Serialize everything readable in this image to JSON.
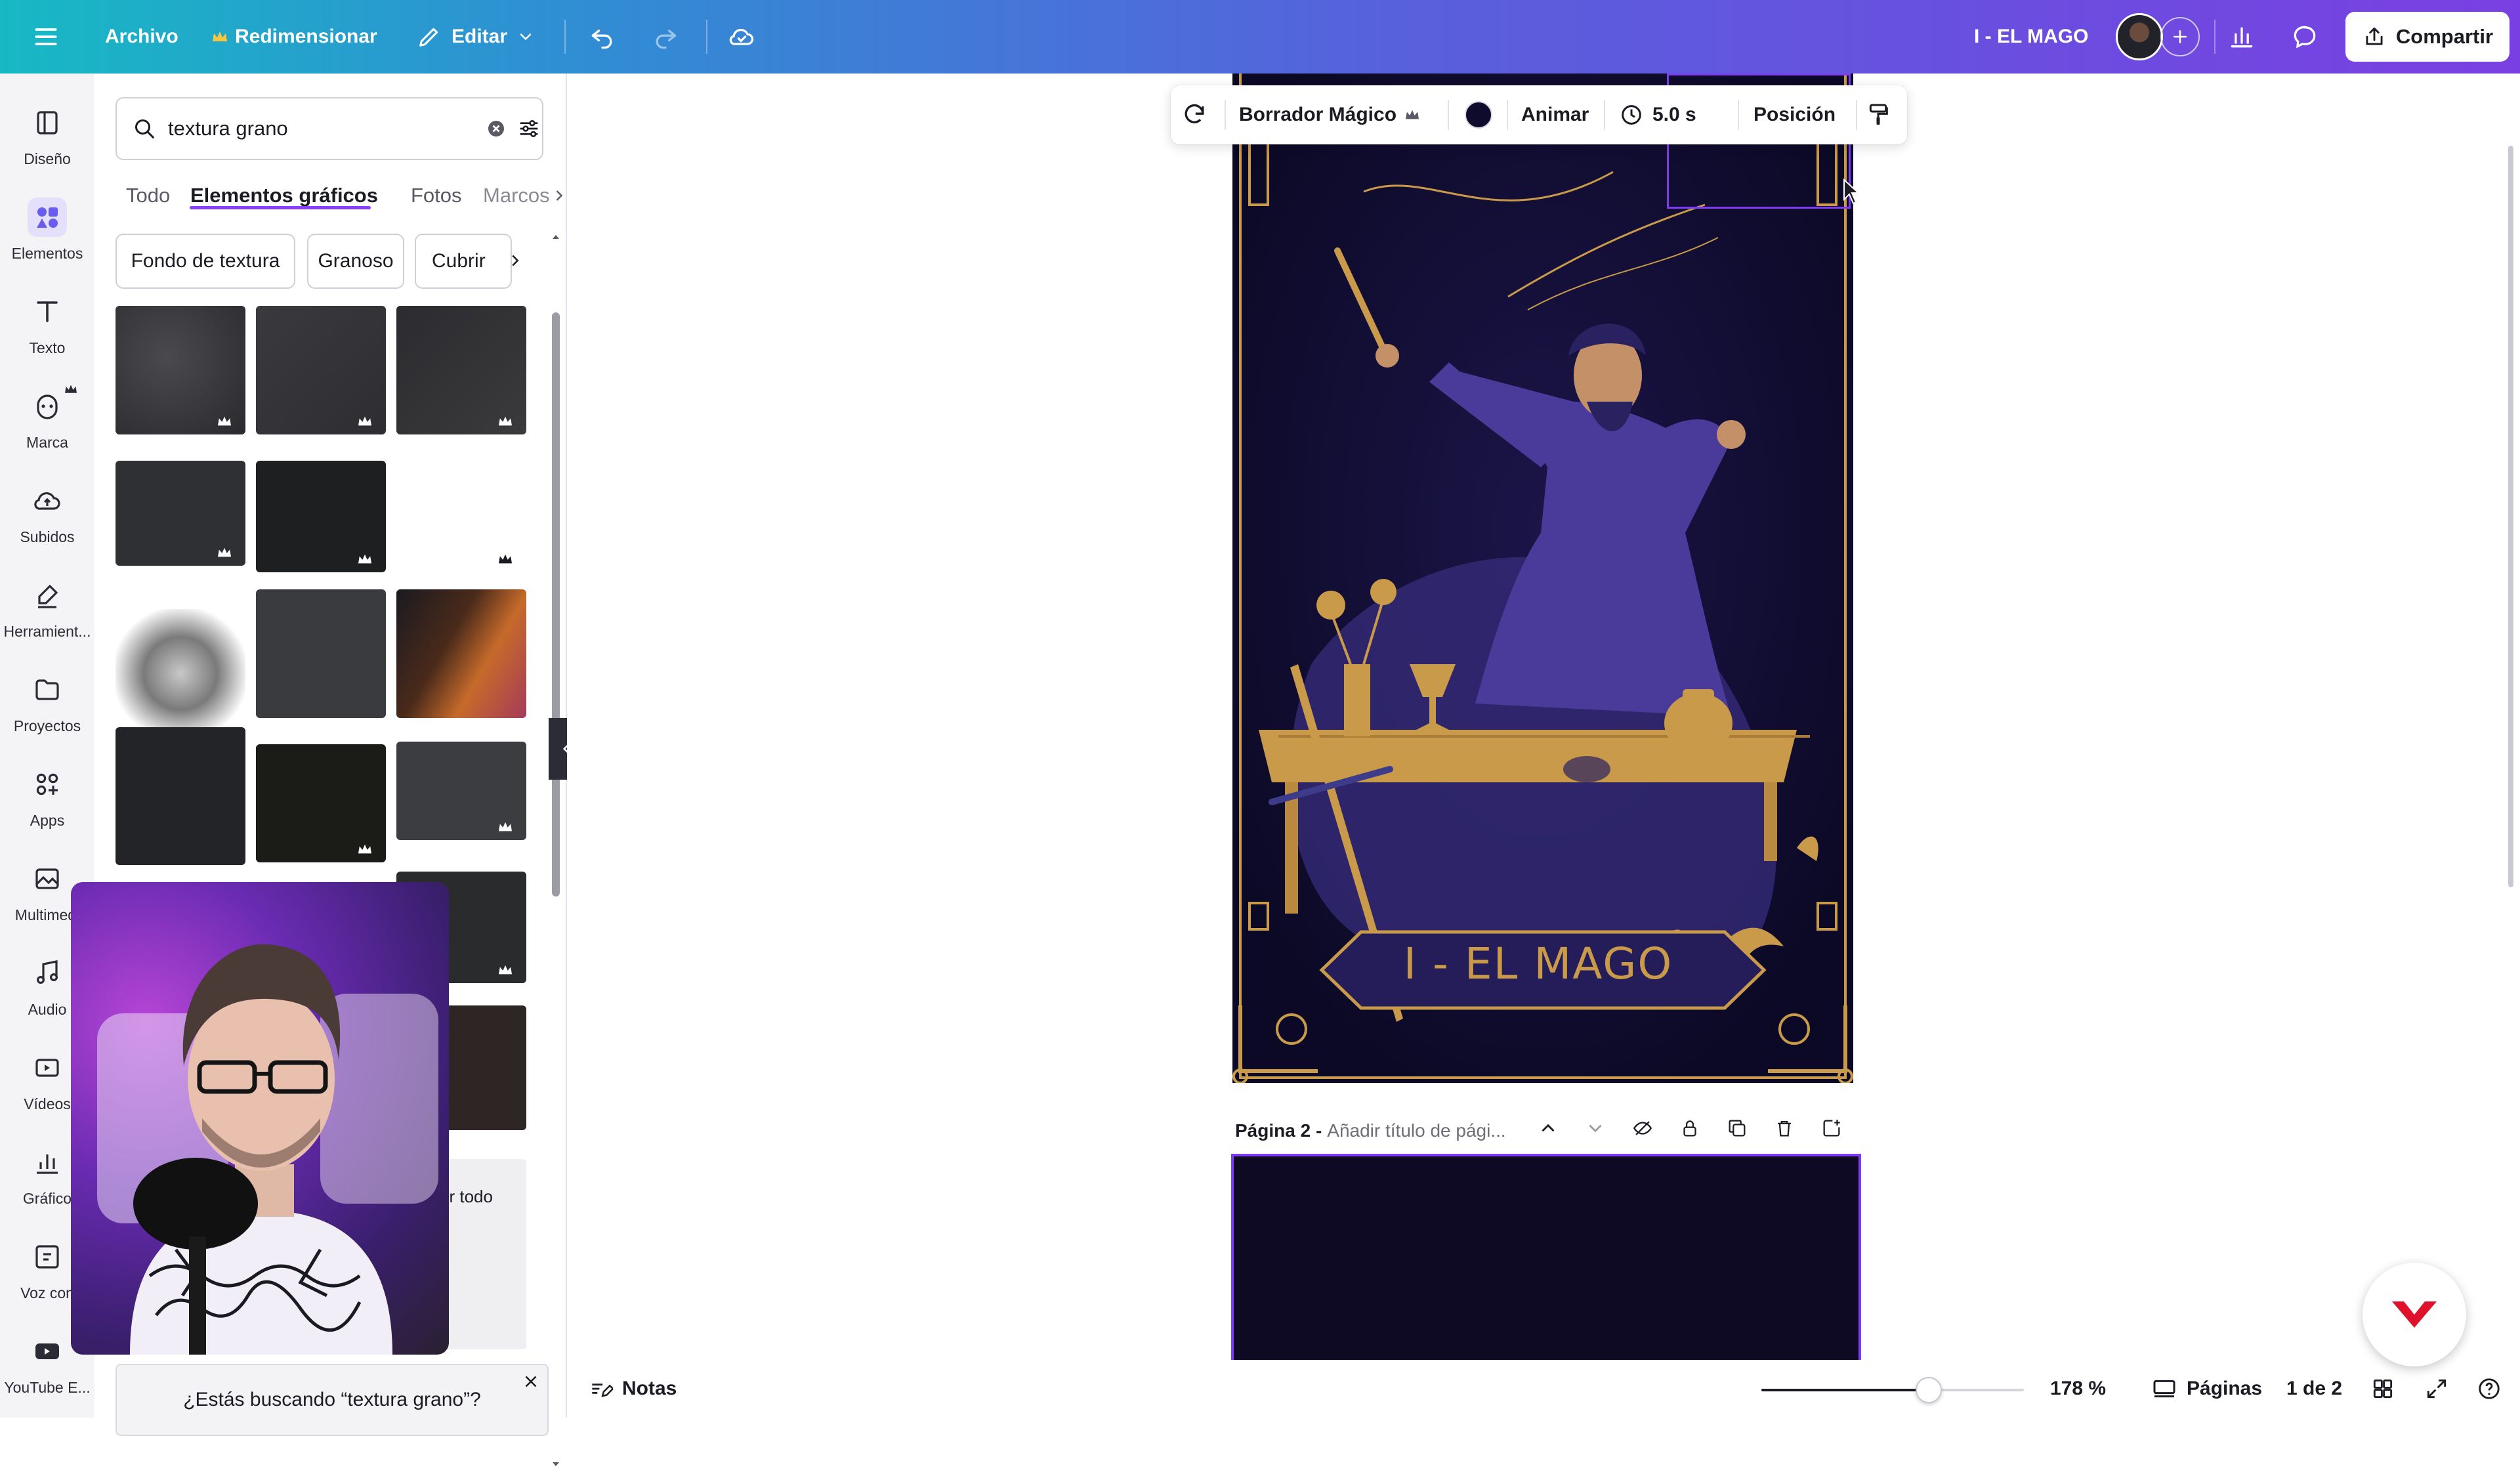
{
  "topbar": {
    "menu_icon": "hamburger-icon",
    "file_label": "Archivo",
    "resize_label": "Redimensionar",
    "edit_label": "Editar",
    "doc_title": "I - EL MAGO",
    "share_label": "Compartir"
  },
  "rail": {
    "items": [
      {
        "label": "Diseño",
        "icon": "layout-icon"
      },
      {
        "label": "Elementos",
        "icon": "elements-icon"
      },
      {
        "label": "Texto",
        "icon": "text-icon"
      },
      {
        "label": "Marca",
        "icon": "brand-icon"
      },
      {
        "label": "Subidos",
        "icon": "upload-cloud-icon"
      },
      {
        "label": "Herramient...",
        "icon": "pen-tool-icon"
      },
      {
        "label": "Proyectos",
        "icon": "folder-icon"
      },
      {
        "label": "Apps",
        "icon": "apps-icon"
      },
      {
        "label": "Multimedi",
        "icon": "media-icon"
      },
      {
        "label": "Audio",
        "icon": "music-icon"
      },
      {
        "label": "Vídeos",
        "icon": "video-icon"
      },
      {
        "label": "Gráfico",
        "icon": "chart-icon"
      },
      {
        "label": "Voz con",
        "icon": "voice-icon"
      },
      {
        "label": "YouTube E...",
        "icon": "youtube-icon"
      }
    ],
    "active": "Elementos"
  },
  "panel": {
    "search_value": "textura grano",
    "tabs": [
      "Todo",
      "Elementos gráficos",
      "Fotos",
      "Marcos"
    ],
    "active_tab": "Elementos gráficos",
    "chips": [
      "Fondo de textura",
      "Granoso",
      "Cubrir"
    ],
    "see_all": "er todo",
    "suggestion": "¿Estás buscando “textura grano”?"
  },
  "context_toolbar": {
    "magic_eraser": "Borrador Mágico",
    "color": "#0f0b2d",
    "animate": "Animar",
    "duration": "5.0 s",
    "position": "Posición"
  },
  "card": {
    "title": "I - EL MAGO"
  },
  "page2": {
    "label": "Página 2 -",
    "title_placeholder": "Añadir título de pági..."
  },
  "bottombar": {
    "notes_label": "Notas",
    "zoom_percent": 178,
    "zoom_label": "178 %",
    "pages_label": "Páginas",
    "page_counter": "1 de 2"
  },
  "colors": {
    "accent": "#8b3dff",
    "card_bg": "#0f0b2d",
    "gold": "#c99a4a",
    "purple_figure": "#4a3a9a"
  }
}
